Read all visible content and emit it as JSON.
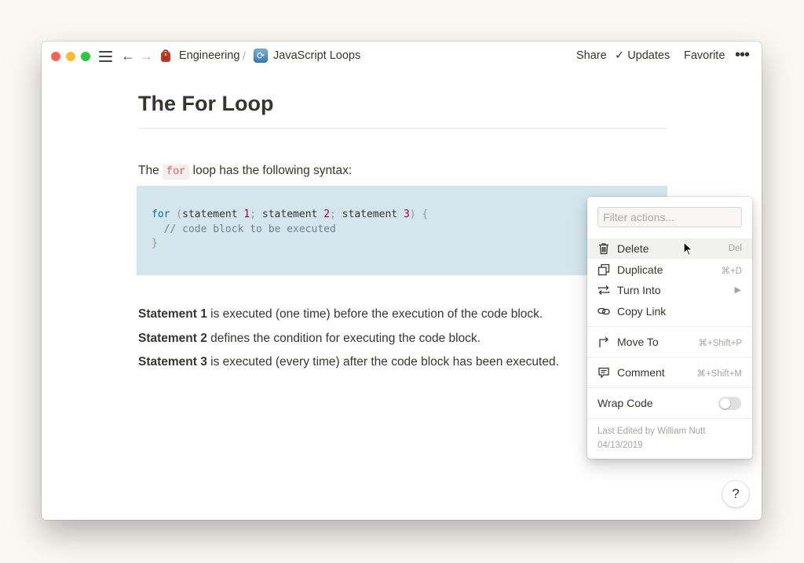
{
  "titlebar": {
    "breadcrumb": [
      {
        "icon": "backpack-icon",
        "label": "Engineering"
      },
      {
        "separator": "/"
      },
      {
        "icon": "refresh-icon",
        "label": "JavaScript Loops"
      }
    ],
    "actions": {
      "share": "Share",
      "updates": "Updates",
      "favorite": "Favorite"
    }
  },
  "page": {
    "title": "The For Loop",
    "intro": {
      "before": "The",
      "code": "for",
      "after": "loop has the following syntax:"
    },
    "code_block": {
      "line1": {
        "kw": "for",
        "p1": " (",
        "s1": "statement ",
        "n1": "1",
        "p2": "; ",
        "s2": "statement ",
        "n2": "2",
        "p3": "; ",
        "s3": "statement ",
        "n3": "3",
        "p4": ") {"
      },
      "line2": "  // code block to be executed",
      "line3": "}"
    },
    "statements": [
      {
        "bold": "Statement 1",
        "text": " is executed (one time) before the execution of the code block."
      },
      {
        "bold": "Statement 2",
        "text": " defines the condition for executing the code block."
      },
      {
        "bold": "Statement 3",
        "text": " is executed (every time) after the code block has been executed."
      }
    ]
  },
  "menu": {
    "filter_placeholder": "Filter actions...",
    "items": [
      {
        "label": "Delete",
        "shortcut": "Del",
        "icon": "trash-icon"
      },
      {
        "label": "Duplicate",
        "shortcut": "⌘+D",
        "icon": "duplicate-icon"
      },
      {
        "label": "Turn Into",
        "shortcut": "▶",
        "icon": "turn-into-icon"
      },
      {
        "label": "Copy Link",
        "shortcut": "",
        "icon": "link-icon"
      },
      {
        "label": "Move To",
        "shortcut": "⌘+Shift+P",
        "icon": "move-to-icon"
      },
      {
        "label": "Comment",
        "shortcut": "⌘+Shift+M",
        "icon": "comment-icon"
      }
    ],
    "wrap_code": {
      "label": "Wrap Code",
      "enabled": false
    },
    "meta": {
      "line1": "Last Edited by William Nutt",
      "line2": "04/13/2019"
    }
  },
  "help": {
    "label": "?"
  },
  "colors": {
    "code_block_bg": "#d3e6ec",
    "inline_code": "#eb5757",
    "text": "#37352f"
  }
}
